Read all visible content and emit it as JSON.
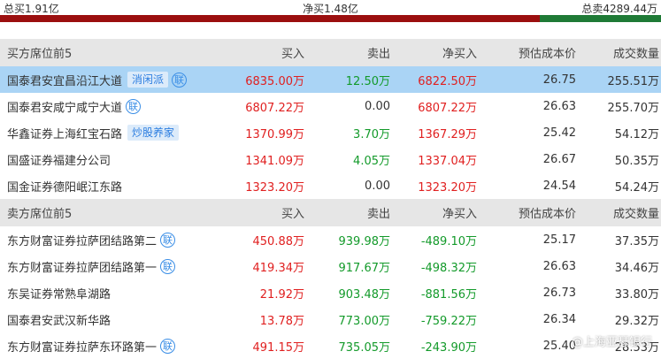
{
  "summary": {
    "total_buy": "总买1.91亿",
    "net_buy": "净买1.48亿",
    "total_sell": "总卖4289.44万",
    "buy_ratio": 0.817,
    "sell_ratio": 0.183,
    "buy_color": "#9b0f0f",
    "sell_color": "#1f7a36"
  },
  "columns": [
    "买入",
    "卖出",
    "净买入",
    "预估成本价",
    "成交数量"
  ],
  "buy_section": {
    "title": "买方席位前5",
    "rows": [
      {
        "name": "国泰君安宜昌沿江大道",
        "tag": "消闲派",
        "lian": "联",
        "buy": "6835.00万",
        "sell": "12.50万",
        "net": "6822.50万",
        "cost": "26.75",
        "volume": "255.51万",
        "selected": true
      },
      {
        "name": "国泰君安咸宁咸宁大道",
        "tag": "",
        "lian": "联",
        "buy": "6807.22万",
        "sell": "0.00",
        "net": "6807.22万",
        "cost": "26.63",
        "volume": "255.70万",
        "selected": false
      },
      {
        "name": "华鑫证券上海红宝石路",
        "tag": "炒股养家",
        "lian": "",
        "buy": "1370.99万",
        "sell": "3.70万",
        "net": "1367.29万",
        "cost": "25.42",
        "volume": "54.12万",
        "selected": false
      },
      {
        "name": "国盛证券福建分公司",
        "tag": "",
        "lian": "",
        "buy": "1341.09万",
        "sell": "4.05万",
        "net": "1337.04万",
        "cost": "26.67",
        "volume": "50.35万",
        "selected": false
      },
      {
        "name": "国金证券德阳岷江东路",
        "tag": "",
        "lian": "",
        "buy": "1323.20万",
        "sell": "0.00",
        "net": "1323.20万",
        "cost": "24.54",
        "volume": "54.24万",
        "selected": false
      }
    ]
  },
  "sell_section": {
    "title": "卖方席位前5",
    "rows": [
      {
        "name": "东方财富证券拉萨团结路第二",
        "tag": "",
        "lian": "联",
        "buy": "450.88万",
        "sell": "939.98万",
        "net": "-489.10万",
        "cost": "25.17",
        "volume": "37.35万",
        "selected": false
      },
      {
        "name": "东方财富证券拉萨团结路第一",
        "tag": "",
        "lian": "联",
        "buy": "419.34万",
        "sell": "917.67万",
        "net": "-498.32万",
        "cost": "26.63",
        "volume": "34.46万",
        "selected": false
      },
      {
        "name": "东吴证券常熟阜湖路",
        "tag": "",
        "lian": "",
        "buy": "21.92万",
        "sell": "903.48万",
        "net": "-881.56万",
        "cost": "26.73",
        "volume": "33.80万",
        "selected": false
      },
      {
        "name": "国泰君安武汉新华路",
        "tag": "",
        "lian": "",
        "buy": "13.78万",
        "sell": "773.00万",
        "net": "-759.22万",
        "cost": "26.34",
        "volume": "29.32万",
        "selected": false
      },
      {
        "name": "东方财富证券拉萨东环路第一",
        "tag": "",
        "lian": "联",
        "buy": "491.15万",
        "sell": "735.05万",
        "net": "-243.90万",
        "cost": "25.40",
        "volume": "28.53万",
        "selected": false
      }
    ]
  },
  "watermark": "@上海亚瑟银行"
}
